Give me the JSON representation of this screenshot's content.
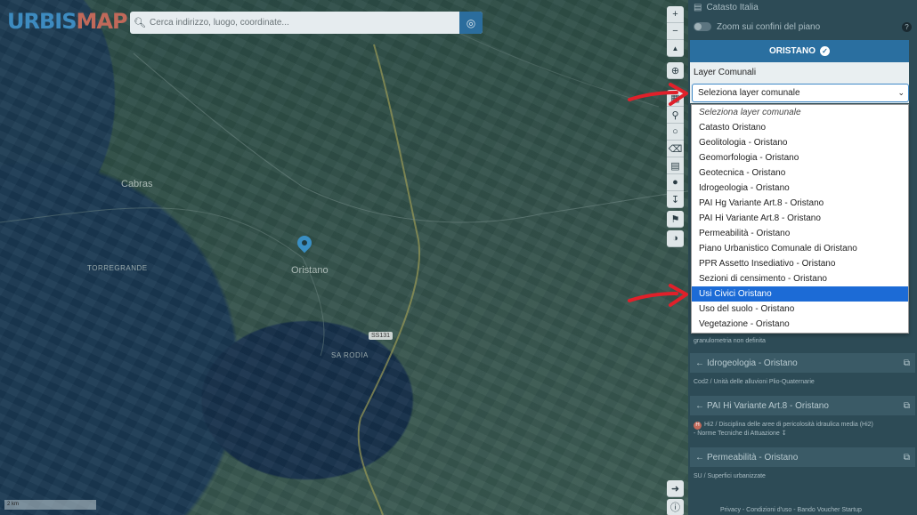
{
  "app": {
    "logo_part1": "URBIS",
    "logo_part2": "MAP"
  },
  "search": {
    "placeholder": "Cerca indirizzo, luogo, coordinate..."
  },
  "map": {
    "labels": {
      "cabras": "Cabras",
      "oristano": "Oristano",
      "torregrande": "TORREGRANDE",
      "sa_rodia": "SA RODIA",
      "road_ss131": "SS131",
      "scale": "2 km"
    }
  },
  "toolbar": {
    "zoom_in": "+",
    "zoom_out": "−",
    "north": "▲"
  },
  "panel": {
    "catasto_label": "Catasto Italia",
    "zoom_label": "Zoom sui confini del piano",
    "help": "?",
    "municipality": "ORISTANO",
    "layer_title": "Layer Comunali",
    "select_value": "Seleziona layer comunale",
    "options": [
      "Seleziona layer comunale",
      "Catasto Oristano",
      "Geolitologia - Oristano",
      "Geomorfologia - Oristano",
      "Geotecnica - Oristano",
      "Idrogeologia - Oristano",
      "PAI Hg Variante Art.8 - Oristano",
      "PAI Hi Variante Art.8 - Oristano",
      "Permeabilità - Oristano",
      "Piano Urbanistico Comunale di Oristano",
      "PPR Assetto Insediativo - Oristano",
      "Sezioni di censimento - Oristano",
      "Usi Civici Oristano",
      "Uso del suolo - Oristano",
      "Vegetazione - Oristano"
    ],
    "selected_option": "Usi Civici Oristano",
    "below": {
      "faint_text": "granulometria non definita",
      "section1": "Idrogeologia - Oristano",
      "section1_detail": "Cod2 / Unità delle alluvioni Plio-Quaternarie",
      "section2": "PAI Hi Variante Art.8 - Oristano",
      "section2_badge": "H",
      "section2_detail": "Hi2 / Disciplina delle aree di pericolosità idraulica media (Hi2)",
      "section2_norme": "- Norme Tecniche di Attuazione",
      "section3": "Permeabilità - Oristano",
      "section3_detail": "SU / Superfici urbanizzate",
      "footer": "Privacy - Condizioni d'uso - Bando Voucher Startup"
    }
  },
  "colors": {
    "accent": "#2a6fa0",
    "selected": "#1c6bd6",
    "annotation_arrow": "#e0202a"
  }
}
